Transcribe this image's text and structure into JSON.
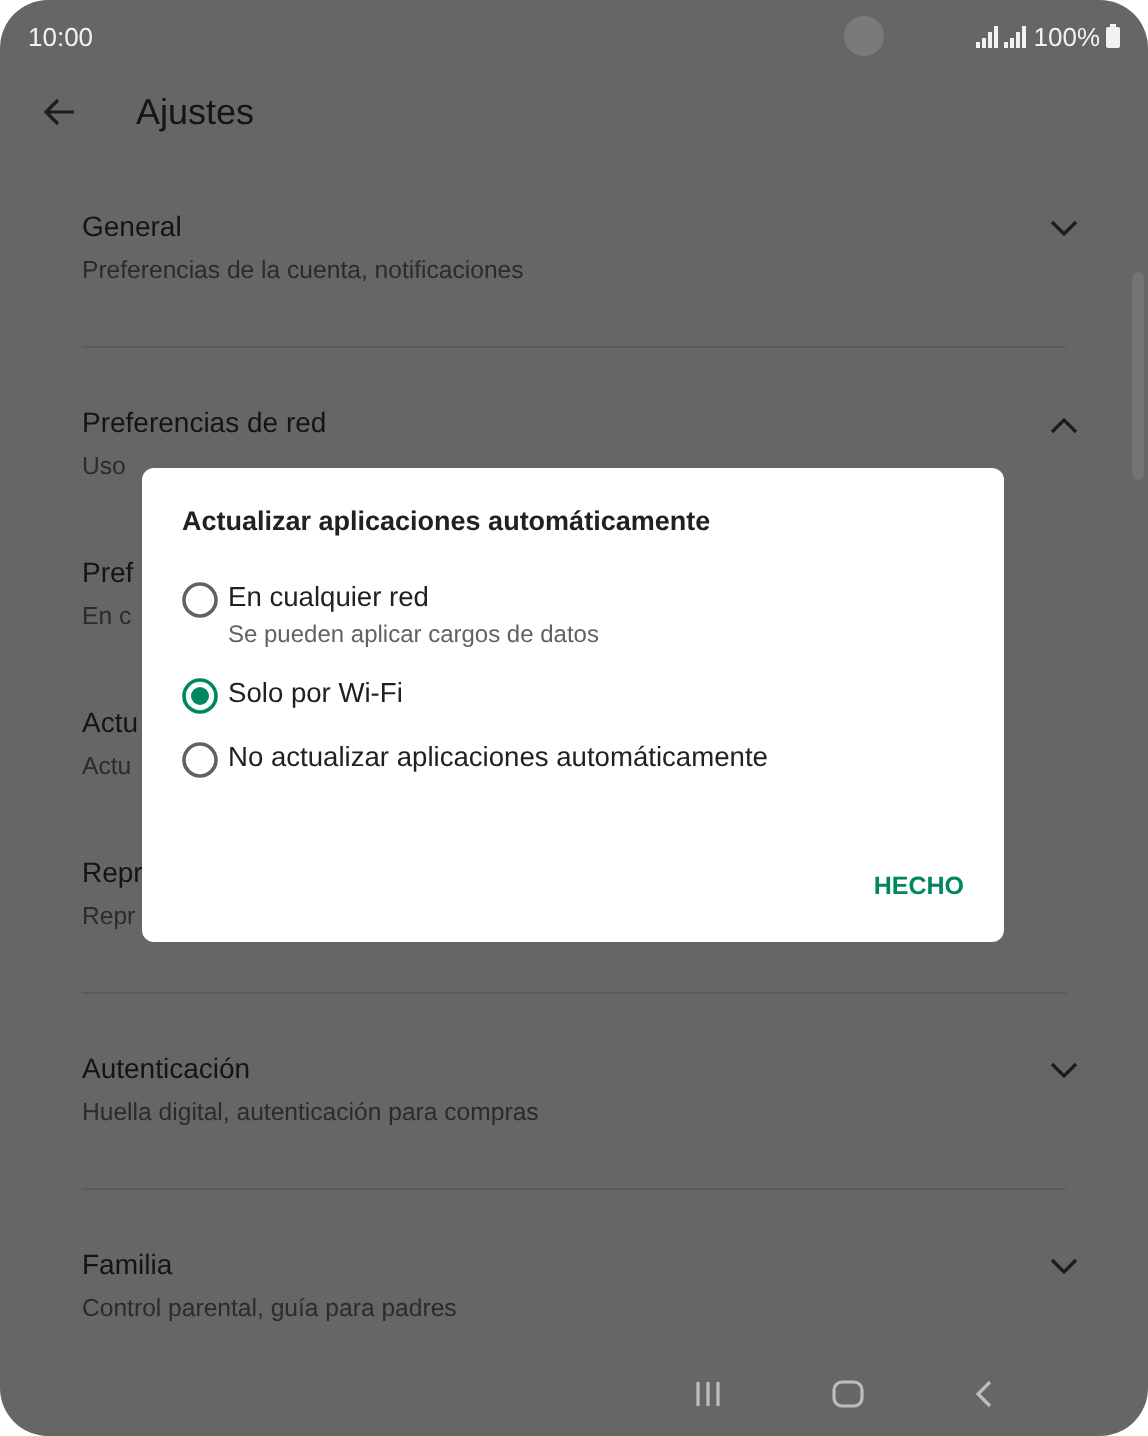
{
  "status_bar": {
    "time": "10:00",
    "battery": "100%"
  },
  "header": {
    "title": "Ajustes"
  },
  "sections": [
    {
      "title": "General",
      "subtitle": "Preferencias de la cuenta, notificaciones",
      "expanded": false
    },
    {
      "title": "Preferencias de red",
      "subtitle": "Uso",
      "expanded": true,
      "items": [
        {
          "title": "Pref",
          "subtitle": "En c"
        },
        {
          "title": "Actu",
          "subtitle": "Actu"
        },
        {
          "title": "Repr",
          "subtitle": "Repr"
        }
      ]
    },
    {
      "title": "Autenticación",
      "subtitle": "Huella digital, autenticación para compras",
      "expanded": false
    },
    {
      "title": "Familia",
      "subtitle": "Control parental, guía para padres",
      "expanded": false
    }
  ],
  "dialog": {
    "title": "Actualizar aplicaciones automáticamente",
    "options": [
      {
        "label": "En cualquier red",
        "description": "Se pueden aplicar cargos de datos",
        "selected": false
      },
      {
        "label": "Solo por Wi-Fi",
        "selected": true
      },
      {
        "label": "No actualizar aplicaciones automáticamente",
        "selected": false
      }
    ],
    "button": "HECHO"
  }
}
